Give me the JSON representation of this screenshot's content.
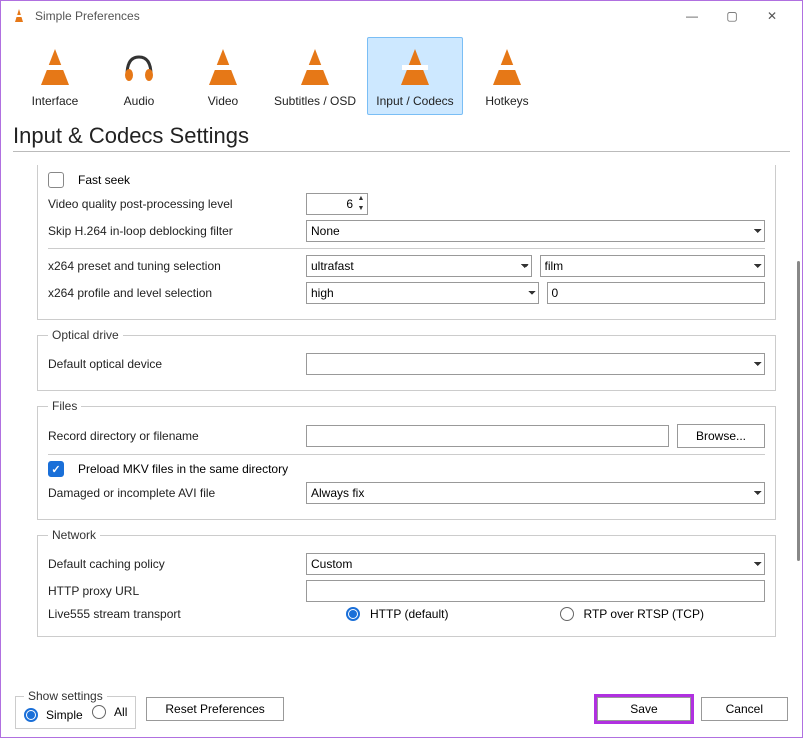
{
  "window": {
    "title": "Simple Preferences",
    "min": "—",
    "max": "▢",
    "close": "✕"
  },
  "categories": {
    "interface": "Interface",
    "audio": "Audio",
    "video": "Video",
    "subtitles": "Subtitles / OSD",
    "input_codecs": "Input / Codecs",
    "hotkeys": "Hotkeys"
  },
  "page_title": "Input & Codecs Settings",
  "codecs": {
    "fast_seek": "Fast seek",
    "pp_level_label": "Video quality post-processing level",
    "pp_level_value": "6",
    "skip_filter_label": "Skip H.264 in-loop deblocking filter",
    "skip_filter_value": "None",
    "x264_preset_label": "x264 preset and tuning selection",
    "x264_preset_value": "ultrafast",
    "x264_tune_value": "film",
    "x264_profile_label": "x264 profile and level selection",
    "x264_profile_value": "high",
    "x264_level_value": "0"
  },
  "optical": {
    "legend": "Optical drive",
    "default_device_label": "Default optical device",
    "default_device_value": ""
  },
  "files": {
    "legend": "Files",
    "record_label": "Record directory or filename",
    "record_value": "",
    "browse": "Browse...",
    "preload_mkv": "Preload MKV files in the same directory",
    "avi_label": "Damaged or incomplete AVI file",
    "avi_value": "Always fix"
  },
  "network": {
    "legend": "Network",
    "caching_label": "Default caching policy",
    "caching_value": "Custom",
    "proxy_label": "HTTP proxy URL",
    "proxy_value": "",
    "live555_label": "Live555 stream transport",
    "live555_http": "HTTP (default)",
    "live555_rtp": "RTP over RTSP (TCP)"
  },
  "footer": {
    "show_settings": "Show settings",
    "simple": "Simple",
    "all": "All",
    "reset": "Reset Preferences",
    "save": "Save",
    "cancel": "Cancel"
  }
}
